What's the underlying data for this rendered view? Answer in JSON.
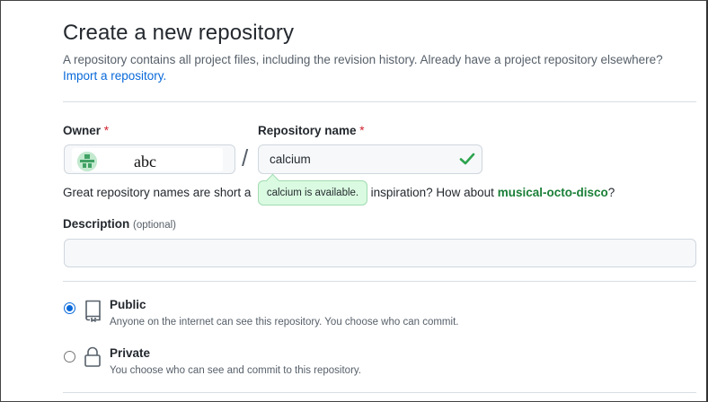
{
  "page": {
    "title": "Create a new repository",
    "subtitle": "A repository contains all project files, including the revision history. Already have a project repository elsewhere?",
    "import_link": "Import a repository."
  },
  "owner": {
    "label": "Owner",
    "required_mark": "*",
    "name": "abc"
  },
  "separator": "/",
  "repository": {
    "label": "Repository name",
    "required_mark": "*",
    "value": "calcium",
    "availability": "calcium is available."
  },
  "hint": {
    "prefix": "Great repository names are short a",
    "suffix": "d inspiration? How about ",
    "suggestion": "musical-octo-disco",
    "end": "?"
  },
  "description": {
    "label": "Description",
    "optional": "(optional)",
    "value": ""
  },
  "visibility": {
    "selected": "public",
    "options": [
      {
        "id": "public",
        "title": "Public",
        "desc": "Anyone on the internet can see this repository. You choose who can commit.",
        "icon": "repo-icon"
      },
      {
        "id": "private",
        "title": "Private",
        "desc": "You choose who can see and commit to this repository.",
        "icon": "lock-icon"
      }
    ]
  },
  "colors": {
    "link": "#0969da",
    "success": "#1a7f37",
    "required": "#cf222e"
  }
}
